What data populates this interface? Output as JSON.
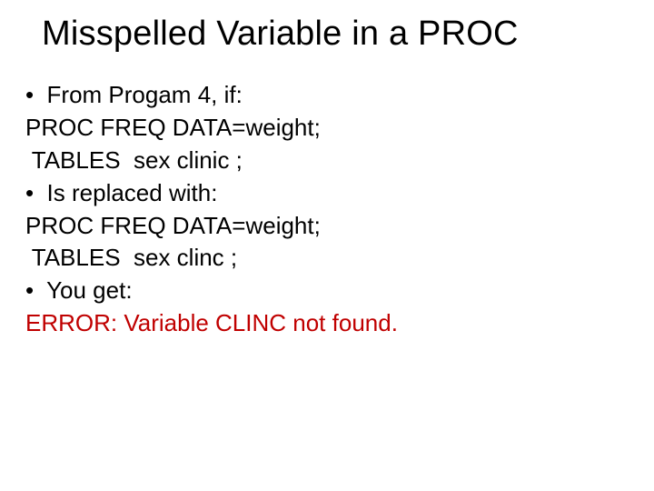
{
  "title": "Misspelled Variable in a PROC",
  "lines": {
    "b1": "•  From Progam 4, if:",
    "code1a": "PROC FREQ DATA=weight;",
    "code1b": " TABLES  sex clinic ;",
    "b2": "•  Is replaced with:",
    "code2a": "PROC FREQ DATA=weight;",
    "code2b": " TABLES  sex clinc ;",
    "b3": "•  You get:",
    "err": "ERROR: Variable CLINC not found."
  }
}
